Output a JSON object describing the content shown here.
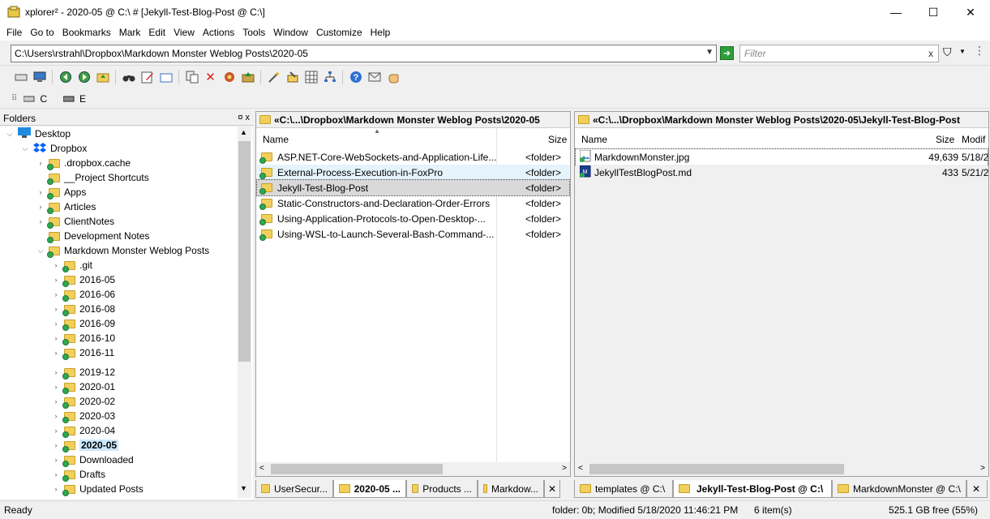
{
  "window": {
    "title": "xplorer² - 2020-05 @ C:\\ # [Jekyll-Test-Blog-Post @ C:\\]",
    "min_label": "—",
    "max_label": "☐",
    "close_label": "✕"
  },
  "menu": [
    "File",
    "Go to",
    "Bookmarks",
    "Mark",
    "Edit",
    "View",
    "Actions",
    "Tools",
    "Window",
    "Customize",
    "Help"
  ],
  "address": {
    "path": "C:\\Users\\rstrahl\\Dropbox\\Markdown Monster Weblog Posts\\2020-05",
    "filter_placeholder": "Filter",
    "filter_clear": "x"
  },
  "drives": [
    {
      "label": "C"
    },
    {
      "label": "E"
    }
  ],
  "folders_pane": {
    "title": "Folders",
    "pin": "¤ x",
    "tree": [
      {
        "label": "Desktop",
        "level": 0,
        "expanded": true
      },
      {
        "label": "Dropbox",
        "level": 1,
        "expanded": true
      },
      {
        "label": ".dropbox.cache",
        "level": 2
      },
      {
        "label": "__Project Shortcuts",
        "level": 2
      },
      {
        "label": "Apps",
        "level": 2
      },
      {
        "label": "Articles",
        "level": 2
      },
      {
        "label": "ClientNotes",
        "level": 2
      },
      {
        "label": "Development Notes",
        "level": 2
      },
      {
        "label": "Markdown Monster Weblog Posts",
        "level": 2,
        "expanded": true
      },
      {
        "label": ".git",
        "level": 3
      },
      {
        "label": "2016-05",
        "level": 3
      },
      {
        "label": "2016-06",
        "level": 3
      },
      {
        "label": "2016-08",
        "level": 3
      },
      {
        "label": "2016-09",
        "level": 3
      },
      {
        "label": "2016-10",
        "level": 3
      },
      {
        "label": "2016-11",
        "level": 3
      },
      {
        "label": "2019-12",
        "level": 3
      },
      {
        "label": "2020-01",
        "level": 3
      },
      {
        "label": "2020-02",
        "level": 3
      },
      {
        "label": "2020-03",
        "level": 3
      },
      {
        "label": "2020-04",
        "level": 3
      },
      {
        "label": "2020-05",
        "level": 3,
        "selected": true
      },
      {
        "label": "Downloaded",
        "level": 3
      },
      {
        "label": "Drafts",
        "level": 3
      },
      {
        "label": "Updated Posts",
        "level": 3
      }
    ]
  },
  "left_pane": {
    "header": "«C:\\...\\Dropbox\\Markdown Monster Weblog Posts\\2020-05",
    "col_name": "Name",
    "col_size": "Size",
    "rows": [
      {
        "name": "ASP.NET-Core-WebSockets-and-Application-Life...",
        "size": "<folder>"
      },
      {
        "name": "External-Process-Execution-in-FoxPro",
        "size": "<folder>"
      },
      {
        "name": "Jekyll-Test-Blog-Post",
        "size": "<folder>",
        "selected": true
      },
      {
        "name": "Static-Constructors-and-Declaration-Order-Errors",
        "size": "<folder>"
      },
      {
        "name": "Using-Application-Protocols-to-Open-Desktop-...",
        "size": "<folder>"
      },
      {
        "name": "Using-WSL-to-Launch-Several-Bash-Command-...",
        "size": "<folder>"
      }
    ],
    "tabs": [
      "UserSecur...",
      "2020-05 ...",
      "Products ...",
      "Markdow..."
    ],
    "tab_close": "✕"
  },
  "right_pane": {
    "header": "«C:\\...\\Dropbox\\Markdown Monster Weblog Posts\\2020-05\\Jekyll-Test-Blog-Post",
    "col_name": "Name",
    "col_size": "Size",
    "col_mod": "Modif",
    "rows": [
      {
        "name": "MarkdownMonster.jpg",
        "size": "49,639",
        "mod": "5/18/2",
        "selected": true
      },
      {
        "name": "JekyllTestBlogPost.md",
        "size": "433",
        "mod": "5/21/2"
      }
    ],
    "tabs": [
      "templates @ C:\\",
      "Jekyll-Test-Blog-Post @ C:\\",
      "MarkdownMonster @ C:\\"
    ],
    "tab_close": "✕"
  },
  "status": {
    "ready": "Ready",
    "info": "folder: 0b; Modified 5/18/2020 11:46:21 PM",
    "items": "6 item(s)",
    "free": "525.1 GB free (55%)"
  }
}
